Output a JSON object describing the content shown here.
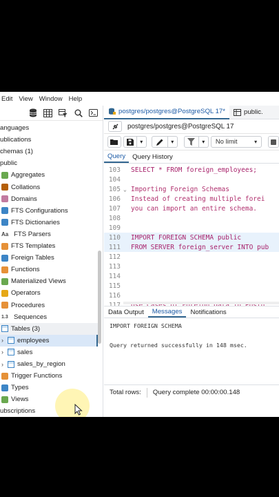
{
  "menu": [
    "Edit",
    "View",
    "Window",
    "Help"
  ],
  "tree": [
    {
      "label": "anguages",
      "icon": "none"
    },
    {
      "label": "ublications",
      "icon": "none"
    },
    {
      "label": "chemas (1)",
      "icon": "none"
    },
    {
      "label": "public",
      "icon": "none"
    },
    {
      "label": "Aggregates",
      "icon": "aggregate-icon"
    },
    {
      "label": "Collations",
      "icon": "collation-icon"
    },
    {
      "label": "Domains",
      "icon": "domain-icon"
    },
    {
      "label": "FTS Configurations",
      "icon": "fts-config-icon"
    },
    {
      "label": "FTS Dictionaries",
      "icon": "fts-dictionary-icon"
    },
    {
      "label": "FTS Parsers",
      "icon": "fts-parser-icon"
    },
    {
      "label": "FTS Templates",
      "icon": "fts-template-icon"
    },
    {
      "label": "Foreign Tables",
      "icon": "foreign-table-icon"
    },
    {
      "label": "Functions",
      "icon": "function-icon"
    },
    {
      "label": "Materialized Views",
      "icon": "matview-icon"
    },
    {
      "label": "Operators",
      "icon": "operator-icon"
    },
    {
      "label": "Procedures",
      "icon": "procedure-icon"
    },
    {
      "label": "Sequences",
      "icon": "sequence-icon"
    },
    {
      "label": "Tables (3)",
      "icon": "table-icon"
    },
    {
      "label": "employees",
      "icon": "table-icon"
    },
    {
      "label": "sales",
      "icon": "table-icon"
    },
    {
      "label": "sales_by_region",
      "icon": "table-icon"
    },
    {
      "label": "Trigger Functions",
      "icon": "trigger-icon"
    },
    {
      "label": "Types",
      "icon": "type-icon"
    },
    {
      "label": "Views",
      "icon": "view-icon"
    },
    {
      "label": "ubscriptions",
      "icon": "none"
    }
  ],
  "sequence_glyph": "1.3",
  "parser_glyph": "Aa",
  "tabs": [
    {
      "label": "postgres/postgres@PostgreSQL 17*"
    },
    {
      "label": "public."
    }
  ],
  "connection": "postgres/postgres@PostgreSQL 17",
  "limit": "No limit",
  "subtabs": [
    "Query",
    "Query History"
  ],
  "editor": {
    "lines": [
      {
        "n": "103",
        "text": "SELECT * FROM foreign_employees;"
      },
      {
        "n": "104",
        "text": ""
      },
      {
        "n": "105",
        "text": " Importing Foreign Schemas"
      },
      {
        "n": "106",
        "text": "Instead of creating multiple forei"
      },
      {
        "n": "107",
        "text": "you can import an entire schema."
      },
      {
        "n": "108",
        "text": ""
      },
      {
        "n": "109",
        "text": ""
      },
      {
        "n": "110",
        "text": "IMPORT FOREIGN SCHEMA public"
      },
      {
        "n": "111",
        "text": "FROM SERVER foreign_server INTO pub"
      },
      {
        "n": "112",
        "text": ""
      },
      {
        "n": "113",
        "text": ""
      },
      {
        "n": "114",
        "text": ""
      },
      {
        "n": "115",
        "text": ""
      },
      {
        "n": "116",
        "text": ""
      },
      {
        "n": "117",
        "text": " Use Cases of Foreign Data in Postg"
      }
    ]
  },
  "output_tabs": [
    "Data Output",
    "Messages",
    "Notifications"
  ],
  "messages": {
    "line1": "IMPORT FOREIGN SCHEMA",
    "line2": "Query returned successfully in 148 msec."
  },
  "status": {
    "total_rows": "Total rows:",
    "complete": "Query complete 00:00:00.148"
  },
  "colors": {
    "accent": "#326690",
    "keyword": "#a8226b",
    "identifier": "#1f5a9c",
    "selection": "#d9e7f8"
  }
}
